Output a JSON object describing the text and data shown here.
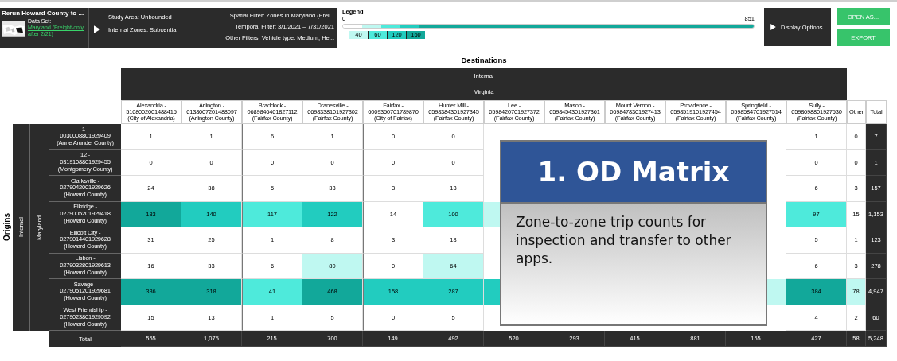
{
  "header": {
    "title": "Rerun Howard County to ...",
    "dataset_label": "Data Set:",
    "dataset_link": "Maryland (Freight-only after 2/21)",
    "study_area": "Study Area: Unbounded",
    "internal_zones": "Internal Zones: Subcentia",
    "spatial_filter": "Spatial Filter: Zones in Maryland (Frei...",
    "temporal_filter": "Temporal Filter: 3/1/2021 – 7/31/2021",
    "other_filters": "Other Filters: Vehicle type: Medium, He..."
  },
  "legend": {
    "title": "Legend",
    "min": "0",
    "max": "851",
    "stops": [
      {
        "label": "40",
        "color": "#bff8f1"
      },
      {
        "label": "60",
        "color": "#4eeadb"
      },
      {
        "label": "120",
        "color": "#22ccbf"
      },
      {
        "label": "160",
        "color": "#12a89a"
      }
    ]
  },
  "buttons": {
    "display_options": "Display Options",
    "open_as": "OPEN AS...",
    "export": "EXPORT"
  },
  "table": {
    "title": "Destinations",
    "group": "Internal",
    "region": "Virginia",
    "origins_label": "Origins",
    "origin_group": "Internal",
    "origin_region": "Maryland",
    "total_label": "Total",
    "columns": [
      {
        "name": "Alexandria -",
        "id": "5108002001488415",
        "county": "(City of Alexandria)"
      },
      {
        "name": "Arlington -",
        "id": "0138007201488097",
        "county": "(Arlington County)"
      },
      {
        "name": "Braddock -",
        "id": "0689846401827112",
        "county": "(Fairfax County)"
      },
      {
        "name": "Dranesville -",
        "id": "0698338101927302",
        "county": "(Fairfax County)"
      },
      {
        "name": "Fairfax -",
        "id": "6009350701789870",
        "county": "(City of Fairfax)"
      },
      {
        "name": "Hunter Mill -",
        "id": "0598384301927345",
        "county": "(Fairfax County)"
      },
      {
        "name": "Lee -",
        "id": "0598420701927372",
        "county": "(Fairfax County)"
      },
      {
        "name": "Mason -",
        "id": "0598454301927361",
        "county": "(Fairfax County)"
      },
      {
        "name": "Mount Vernon -",
        "id": "0698478301927413",
        "county": "(Fairfax County)"
      },
      {
        "name": "Providence -",
        "id": "0598519101927454",
        "county": "(Fairfax County)"
      },
      {
        "name": "Springfield -",
        "id": "0598584701927514",
        "county": "(Fairfax County)"
      },
      {
        "name": "Sully -",
        "id": "0598698801927530",
        "county": "(Fairfax County)"
      }
    ],
    "other_label": "Other",
    "total_col_label": "Total",
    "rows": [
      {
        "name": "1 -",
        "id": "0030008801929409",
        "county": "(Anne Arundel County)",
        "cells": [
          {
            "value": "1"
          },
          {
            "value": "1"
          },
          {
            "value": "6"
          },
          {
            "value": "1"
          },
          {
            "value": "0"
          },
          {
            "value": "0"
          },
          {},
          {},
          {},
          {},
          {},
          {
            "value": "1"
          }
        ],
        "other": {
          "value": "0"
        },
        "total": "7"
      },
      {
        "name": "12 -",
        "id": "0319108801929455",
        "county": "(Montgomery County)",
        "cells": [
          {
            "value": "0"
          },
          {
            "value": "0"
          },
          {
            "value": "0"
          },
          {
            "value": "0"
          },
          {
            "value": "0"
          },
          {
            "value": "0"
          },
          {},
          {},
          {},
          {},
          {},
          {
            "value": "0"
          }
        ],
        "other": {
          "value": "0"
        },
        "total": "1"
      },
      {
        "name": "Clarksville -",
        "id": "0279042001929626",
        "county": "(Howard County)",
        "cells": [
          {
            "value": "24"
          },
          {
            "value": "38"
          },
          {
            "value": "5"
          },
          {
            "value": "33"
          },
          {
            "value": "3"
          },
          {
            "value": "13"
          },
          {},
          {},
          {},
          {},
          {},
          {
            "value": "6"
          }
        ],
        "other": {
          "value": "3"
        },
        "total": "157"
      },
      {
        "name": "Elkridge -",
        "id": "0279005201929418",
        "county": "(Howard County)",
        "cells": [
          {
            "value": "183",
            "color": "#12a89a"
          },
          {
            "value": "140",
            "color": "#22ccbf"
          },
          {
            "value": "117",
            "color": "#4eeadb"
          },
          {
            "value": "122",
            "color": "#22ccbf"
          },
          {
            "value": "14"
          },
          {
            "value": "100",
            "color": "#4eeadb"
          },
          {
            "color": "#bff8f1"
          },
          {},
          {},
          {},
          {},
          {
            "value": "97",
            "color": "#4eeadb"
          }
        ],
        "other": {
          "value": "15"
        },
        "total": "1,153"
      },
      {
        "name": "Ellicott City -",
        "id": "0279014401929628",
        "county": "(Howard County)",
        "cells": [
          {
            "value": "31"
          },
          {
            "value": "25"
          },
          {
            "value": "1"
          },
          {
            "value": "8"
          },
          {
            "value": "3"
          },
          {
            "value": "18"
          },
          {},
          {},
          {},
          {},
          {},
          {
            "value": "5"
          }
        ],
        "other": {
          "value": "1"
        },
        "total": "123"
      },
      {
        "name": "Lisbon -",
        "id": "0279032801929613",
        "county": "(Howard County)",
        "cells": [
          {
            "value": "16"
          },
          {
            "value": "33"
          },
          {
            "value": "6"
          },
          {
            "value": "80",
            "color": "#bff8f1"
          },
          {
            "value": "0"
          },
          {
            "value": "64",
            "color": "#bff8f1"
          },
          {},
          {},
          {},
          {},
          {},
          {
            "value": "6"
          }
        ],
        "other": {
          "value": "3"
        },
        "total": "278"
      },
      {
        "name": "Savage -",
        "id": "0279051201929681",
        "county": "(Howard County)",
        "cells": [
          {
            "value": "336",
            "color": "#12a89a"
          },
          {
            "value": "318",
            "color": "#12a89a"
          },
          {
            "value": "41",
            "color": "#4eeadb"
          },
          {
            "value": "468",
            "color": "#12a89a"
          },
          {
            "value": "158",
            "color": "#22ccbf"
          },
          {
            "value": "287",
            "color": "#22ccbf"
          },
          {
            "color": "#22ccbf"
          },
          {},
          {},
          {},
          {
            "color": "#bff8f1"
          },
          {
            "value": "384",
            "color": "#12a89a"
          }
        ],
        "other": {
          "value": "78",
          "color": "#bff8f1"
        },
        "total": "4,947"
      },
      {
        "name": "West Friendship -",
        "id": "0279023801929592",
        "county": "(Howard County)",
        "cells": [
          {
            "value": "15"
          },
          {
            "value": "13"
          },
          {
            "value": "1"
          },
          {
            "value": "5"
          },
          {
            "value": "0"
          },
          {
            "value": "5"
          },
          {},
          {},
          {},
          {},
          {},
          {
            "value": "4"
          }
        ],
        "other": {
          "value": "2"
        },
        "total": "60"
      }
    ],
    "totals": [
      "555",
      "1,075",
      "215",
      "700",
      "149",
      "492",
      "520",
      "293",
      "415",
      "881",
      "155",
      "427"
    ],
    "totals_other": "58",
    "totals_total": "5,248"
  },
  "callout": {
    "title": "1. OD Matrix",
    "text": "Zone-to-zone trip counts for inspection and transfer to other apps."
  }
}
